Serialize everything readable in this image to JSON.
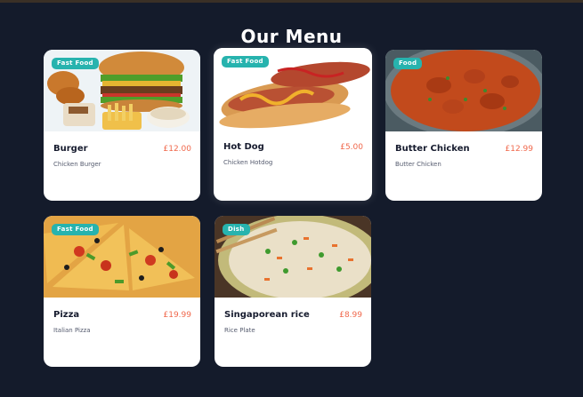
{
  "header": {
    "title": "Our Menu"
  },
  "menu_items": [
    {
      "name": "Burger",
      "price": "£12.00",
      "description": "Chicken Burger",
      "badge": "Fast Food",
      "image_icon": "burger-image"
    },
    {
      "name": "Hot Dog",
      "price": "£5.00",
      "description": "Chicken Hotdog",
      "badge": "Fast Food",
      "image_icon": "hotdog-image"
    },
    {
      "name": "Butter Chicken",
      "price": "£12.99",
      "description": "Butter Chicken",
      "badge": "Food",
      "image_icon": "curry-image"
    },
    {
      "name": "Pizza",
      "price": "£19.99",
      "description": "Italian Pizza",
      "badge": "Fast Food",
      "image_icon": "pizza-image"
    },
    {
      "name": "Singaporean rice",
      "price": "£8.99",
      "description": "Rice Plate",
      "badge": "Dish",
      "image_icon": "rice-image"
    }
  ],
  "colors": {
    "background": "#141b2b",
    "badge": "#27b3ae",
    "price": "#f0684c"
  }
}
